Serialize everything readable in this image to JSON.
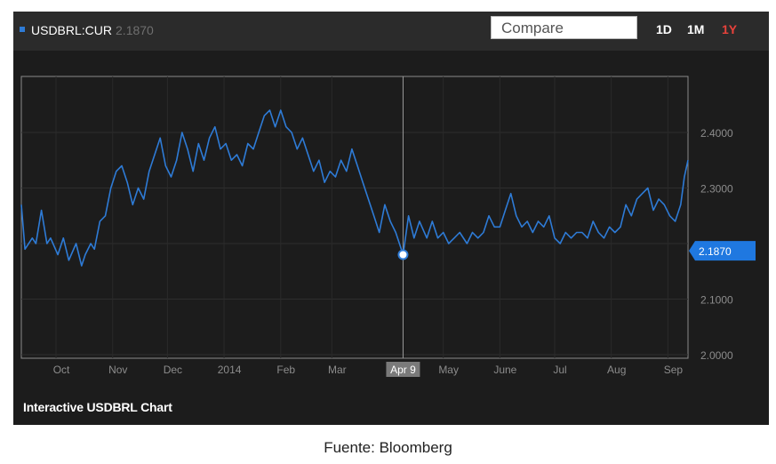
{
  "header": {
    "symbol": "USDBRL:CUR",
    "price": "2.1870",
    "compare_placeholder": "Compare",
    "ranges": [
      {
        "label": "1D",
        "active": false
      },
      {
        "label": "1M",
        "active": false
      },
      {
        "label": "1Y",
        "active": true
      }
    ]
  },
  "footer_title": "Interactive USDBRL Chart",
  "source": "Fuente: Bloomberg",
  "colors": {
    "line": "#2e7bd6",
    "active_range": "#e8423b",
    "price_tag": "#1f78e0"
  },
  "chart_data": {
    "type": "line",
    "x_tick_labels": [
      "Oct",
      "Nov",
      "Dec",
      "2014",
      "Feb",
      "Mar",
      "May",
      "June",
      "Jul",
      "Aug",
      "Sep"
    ],
    "y_tick_labels": [
      "2.4000",
      "2.3000",
      "2.1000",
      "2.0000"
    ],
    "ylim": [
      2.0,
      2.4
    ],
    "y_ticks": [
      2.4,
      2.3,
      2.1,
      2.0
    ],
    "grid": true,
    "crosshair_label": "Apr 9",
    "crosshair_value": 2.18,
    "last_value_label": "2.1870",
    "last_value": 2.187,
    "x_dates": [
      "2013-09-12",
      "2013-09-14",
      "2013-09-18",
      "2013-09-20",
      "2013-09-23",
      "2013-09-26",
      "2013-09-28",
      "2013-10-02",
      "2013-10-05",
      "2013-10-08",
      "2013-10-12",
      "2013-10-15",
      "2013-10-17",
      "2013-10-20",
      "2013-10-22",
      "2013-10-25",
      "2013-10-28",
      "2013-10-31",
      "2013-11-03",
      "2013-11-06",
      "2013-11-09",
      "2013-11-12",
      "2013-11-15",
      "2013-11-18",
      "2013-11-21",
      "2013-11-24",
      "2013-11-27",
      "2013-11-30",
      "2013-12-03",
      "2013-12-06",
      "2013-12-09",
      "2013-12-12",
      "2013-12-15",
      "2013-12-18",
      "2013-12-21",
      "2013-12-24",
      "2013-12-27",
      "2013-12-30",
      "2014-01-02",
      "2014-01-05",
      "2014-01-08",
      "2014-01-11",
      "2014-01-14",
      "2014-01-17",
      "2014-01-20",
      "2014-01-23",
      "2014-01-26",
      "2014-01-29",
      "2014-02-01",
      "2014-02-04",
      "2014-02-07",
      "2014-02-10",
      "2014-02-13",
      "2014-02-16",
      "2014-02-19",
      "2014-02-22",
      "2014-02-25",
      "2014-02-28",
      "2014-03-03",
      "2014-03-06",
      "2014-03-09",
      "2014-03-12",
      "2014-03-15",
      "2014-03-18",
      "2014-03-21",
      "2014-03-24",
      "2014-03-27",
      "2014-03-30",
      "2014-04-02",
      "2014-04-05",
      "2014-04-09",
      "2014-04-12",
      "2014-04-15",
      "2014-04-18",
      "2014-04-22",
      "2014-04-25",
      "2014-04-28",
      "2014-05-01",
      "2014-05-04",
      "2014-05-07",
      "2014-05-10",
      "2014-05-14",
      "2014-05-17",
      "2014-05-20",
      "2014-05-23",
      "2014-05-26",
      "2014-05-29",
      "2014-06-01",
      "2014-06-04",
      "2014-06-07",
      "2014-06-10",
      "2014-06-13",
      "2014-06-16",
      "2014-06-19",
      "2014-06-22",
      "2014-06-25",
      "2014-06-28",
      "2014-07-01",
      "2014-07-04",
      "2014-07-07",
      "2014-07-10",
      "2014-07-13",
      "2014-07-16",
      "2014-07-19",
      "2014-07-22",
      "2014-07-25",
      "2014-07-28",
      "2014-07-31",
      "2014-08-03",
      "2014-08-06",
      "2014-08-09",
      "2014-08-12",
      "2014-08-15",
      "2014-08-18",
      "2014-08-21",
      "2014-08-24",
      "2014-08-27",
      "2014-08-30",
      "2014-09-02",
      "2014-09-05",
      "2014-09-08",
      "2014-09-10",
      "2014-09-12"
    ],
    "y_values": [
      2.27,
      2.19,
      2.21,
      2.2,
      2.26,
      2.2,
      2.21,
      2.18,
      2.21,
      2.17,
      2.2,
      2.16,
      2.18,
      2.2,
      2.19,
      2.24,
      2.25,
      2.3,
      2.33,
      2.34,
      2.31,
      2.27,
      2.3,
      2.28,
      2.33,
      2.36,
      2.39,
      2.34,
      2.32,
      2.35,
      2.4,
      2.37,
      2.33,
      2.38,
      2.35,
      2.39,
      2.41,
      2.37,
      2.38,
      2.35,
      2.36,
      2.34,
      2.38,
      2.37,
      2.4,
      2.43,
      2.44,
      2.41,
      2.44,
      2.41,
      2.4,
      2.37,
      2.39,
      2.36,
      2.33,
      2.35,
      2.31,
      2.33,
      2.32,
      2.35,
      2.33,
      2.37,
      2.34,
      2.31,
      2.28,
      2.25,
      2.22,
      2.27,
      2.24,
      2.22,
      2.18,
      2.25,
      2.21,
      2.24,
      2.21,
      2.24,
      2.21,
      2.22,
      2.2,
      2.21,
      2.22,
      2.2,
      2.22,
      2.21,
      2.22,
      2.25,
      2.23,
      2.23,
      2.26,
      2.29,
      2.25,
      2.23,
      2.24,
      2.22,
      2.24,
      2.23,
      2.25,
      2.21,
      2.2,
      2.22,
      2.21,
      2.22,
      2.22,
      2.21,
      2.24,
      2.22,
      2.21,
      2.23,
      2.22,
      2.23,
      2.27,
      2.25,
      2.28,
      2.29,
      2.3,
      2.26,
      2.28,
      2.27,
      2.25,
      2.24,
      2.27,
      2.32,
      2.35
    ]
  }
}
